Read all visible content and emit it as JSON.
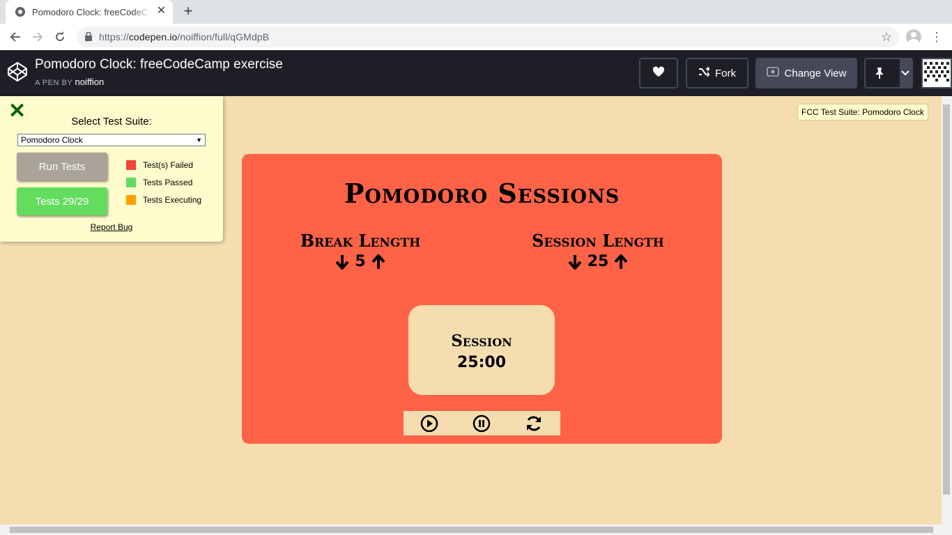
{
  "browser": {
    "tab_title": "Pomodoro Clock: freeCodeCamp exercise",
    "url_prefix": "https://",
    "url_host": "codepen.io",
    "url_path": "/noiffion/full/qGMdpB"
  },
  "codepen": {
    "pen_title": "Pomodoro Clock: freeCodeCamp exercise",
    "pen_by": "A PEN BY",
    "author": "noiffion",
    "fork_label": "Fork",
    "change_view_label": "Change View"
  },
  "fcc_panel": {
    "select_label": "Select Test Suite:",
    "selected_suite": "Pomodoro Clock",
    "run_tests": "Run Tests",
    "tests_result": "Tests 29/29",
    "legend": [
      {
        "label": "Test(s) Failed",
        "color": "#f44336"
      },
      {
        "label": "Tests Passed",
        "color": "#64dc5e"
      },
      {
        "label": "Tests Executing",
        "color": "#ffa000"
      }
    ],
    "report_bug": "Report Bug"
  },
  "suite_tag": "FCC Test Suite: Pomodoro Clock",
  "pomodoro": {
    "title": "Pomodoro Sessions",
    "break_label": "Break Length",
    "break_value": "5",
    "session_label": "Session Length",
    "session_value": "25",
    "timer_label": "Session",
    "timer_value": "25:00"
  },
  "colors": {
    "page_bg": "#f5ddb0",
    "card_bg": "#ff6347",
    "codepen_header": "#1e1f26"
  }
}
